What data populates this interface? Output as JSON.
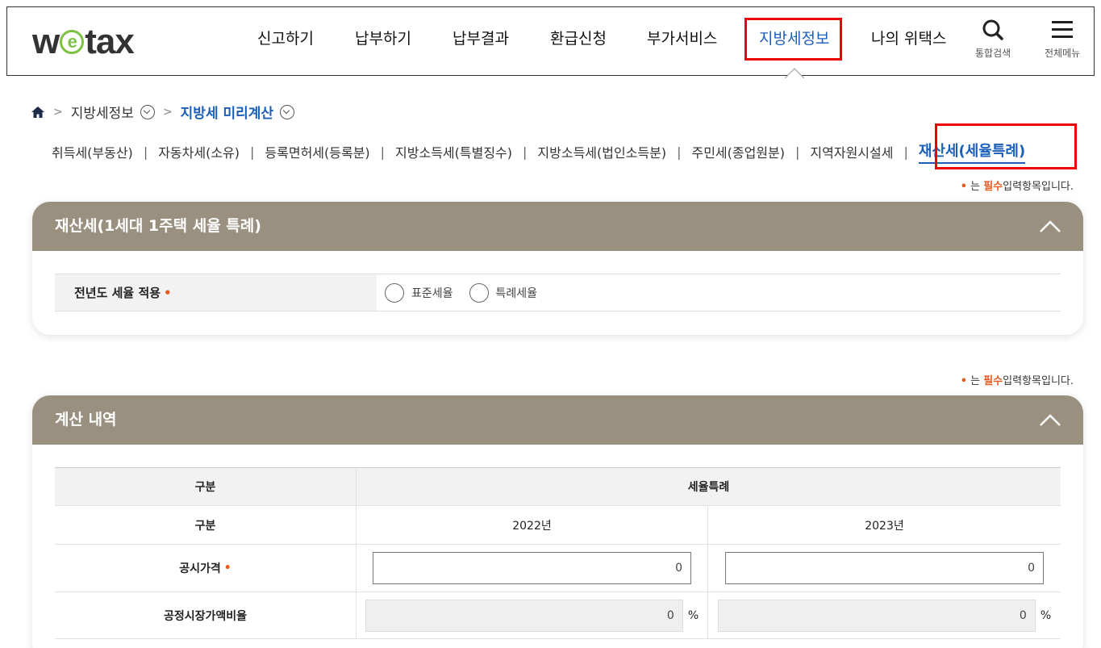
{
  "header": {
    "logo_left": "w",
    "logo_e": "e",
    "logo_right": "tax",
    "nav": [
      {
        "label": "신고하기",
        "name": "nav-file-return"
      },
      {
        "label": "납부하기",
        "name": "nav-pay"
      },
      {
        "label": "납부결과",
        "name": "nav-pay-result"
      },
      {
        "label": "환급신청",
        "name": "nav-refund"
      },
      {
        "label": "부가서비스",
        "name": "nav-extra-service"
      },
      {
        "label": "지방세정보",
        "name": "nav-local-tax-info"
      },
      {
        "label": "나의 위택스",
        "name": "nav-my-wetax"
      }
    ],
    "search_label": "통합검색",
    "menu_label": "전체메뉴"
  },
  "breadcrumb": {
    "level1": "지방세정보",
    "level2": "지방세 미리계산"
  },
  "tabs": [
    "취득세(부동산)",
    "자동차세(소유)",
    "등록면허세(등록분)",
    "지방소득세(특별징수)",
    "지방소득세(법인소득분)",
    "주민세(종업원분)",
    "지역자원시설세",
    "재산세(세율특례)"
  ],
  "required_note": {
    "dot": "•",
    "prefix": "는",
    "required": "필수",
    "suffix": "입력항목입니다."
  },
  "panel1": {
    "title": "재산세(1세대 1주택 세율 특례)",
    "row_label": "전년도 세율 적용",
    "option1": "표준세율",
    "option2": "특례세율"
  },
  "panel2": {
    "title": "계산 내역",
    "head_col0": "구분",
    "head_col1": "세율특례",
    "sub_col0": "구분",
    "year1": "2022년",
    "year2": "2023년",
    "row1_label": "공시가격",
    "row1_val1": "0",
    "row1_val2": "0",
    "row2_label": "공정시장가액비율",
    "row2_val1": "0",
    "row2_val2": "0",
    "pct": "%"
  },
  "colors": {
    "accent": "#1c5fb8",
    "panel_header": "#9a9080",
    "required": "#e65a1f",
    "highlight_box": "#ee0000"
  }
}
